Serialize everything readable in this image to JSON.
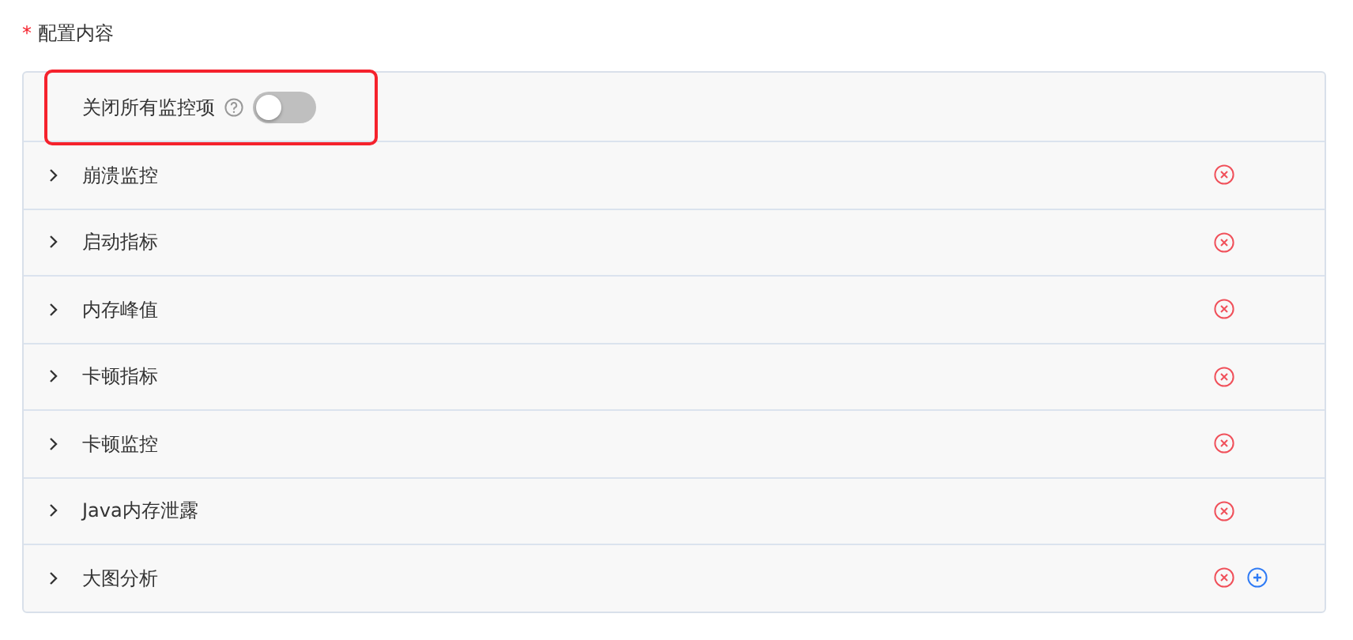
{
  "field": {
    "required_mark": "*",
    "label": "配置内容"
  },
  "master_switch": {
    "label": "关闭所有监控项",
    "on": false,
    "highlighted": true
  },
  "items": [
    {
      "title": "崩溃监控",
      "expanded": false,
      "can_add": false
    },
    {
      "title": "启动指标",
      "expanded": false,
      "can_add": false
    },
    {
      "title": "内存峰值",
      "expanded": false,
      "can_add": false
    },
    {
      "title": "卡顿指标",
      "expanded": false,
      "can_add": false
    },
    {
      "title": "卡顿监控",
      "expanded": false,
      "can_add": false
    },
    {
      "title": "Java内存泄露",
      "expanded": false,
      "can_add": false
    },
    {
      "title": "大图分析",
      "expanded": false,
      "can_add": true
    }
  ]
}
